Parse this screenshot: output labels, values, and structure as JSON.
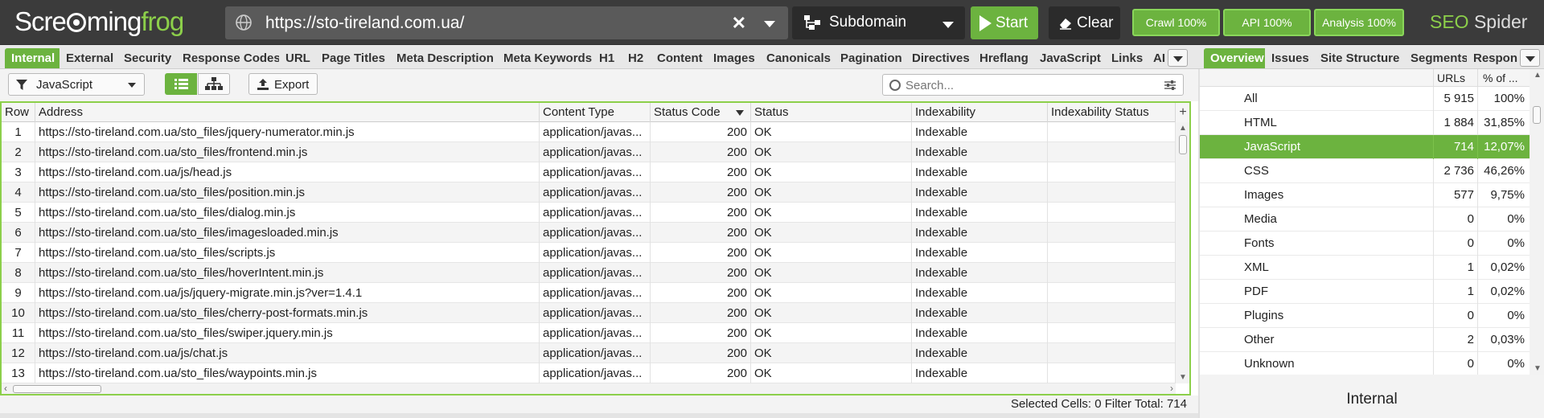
{
  "app": {
    "logo_part1": "Scre",
    "logo_part2": "ming",
    "logo_part3": "frog",
    "brand_seo": "SEO",
    "brand_spider": "Spider",
    "colors": {
      "accent": "#6cb33f",
      "topbar": "#3b3b3b"
    }
  },
  "topbar": {
    "url": "https://sto-tireland.com.ua/",
    "mode": "Subdomain",
    "start_label": "Start",
    "clear_label": "Clear",
    "crawl_label": "Crawl 100%",
    "api_label": "API 100%",
    "analysis_label": "Analysis 100%",
    "icons": [
      "globe-icon",
      "close-icon",
      "chevron-down-icon",
      "sitemap-icon",
      "play-icon",
      "eraser-icon"
    ]
  },
  "tabs": [
    "Internal",
    "External",
    "Security",
    "Response Codes",
    "URL",
    "Page Titles",
    "Meta Description",
    "Meta Keywords",
    "H1",
    "H2",
    "Content",
    "Images",
    "Canonicals",
    "Pagination",
    "Directives",
    "Hreflang",
    "JavaScript",
    "Links",
    "AI"
  ],
  "right_tabs": [
    "Overview",
    "Issues",
    "Site Structure",
    "Segments",
    "Respon"
  ],
  "toolbar": {
    "filter": "JavaScript",
    "export_label": "Export",
    "search_placeholder": "Search..."
  },
  "grid": {
    "columns": [
      "Row",
      "Address",
      "Content Type",
      "Status Code",
      "Status",
      "Indexability",
      "Indexability Status"
    ],
    "rows": [
      [
        "1",
        "https://sto-tireland.com.ua/sto_files/jquery-numerator.min.js",
        "application/javas...",
        "200",
        "OK",
        "Indexable",
        ""
      ],
      [
        "2",
        "https://sto-tireland.com.ua/sto_files/frontend.min.js",
        "application/javas...",
        "200",
        "OK",
        "Indexable",
        ""
      ],
      [
        "3",
        "https://sto-tireland.com.ua/js/head.js",
        "application/javas...",
        "200",
        "OK",
        "Indexable",
        ""
      ],
      [
        "4",
        "https://sto-tireland.com.ua/sto_files/position.min.js",
        "application/javas...",
        "200",
        "OK",
        "Indexable",
        ""
      ],
      [
        "5",
        "https://sto-tireland.com.ua/sto_files/dialog.min.js",
        "application/javas...",
        "200",
        "OK",
        "Indexable",
        ""
      ],
      [
        "6",
        "https://sto-tireland.com.ua/sto_files/imagesloaded.min.js",
        "application/javas...",
        "200",
        "OK",
        "Indexable",
        ""
      ],
      [
        "7",
        "https://sto-tireland.com.ua/sto_files/scripts.js",
        "application/javas...",
        "200",
        "OK",
        "Indexable",
        ""
      ],
      [
        "8",
        "https://sto-tireland.com.ua/sto_files/hoverIntent.min.js",
        "application/javas...",
        "200",
        "OK",
        "Indexable",
        ""
      ],
      [
        "9",
        "https://sto-tireland.com.ua/js/jquery-migrate.min.js?ver=1.4.1",
        "application/javas...",
        "200",
        "OK",
        "Indexable",
        ""
      ],
      [
        "10",
        "https://sto-tireland.com.ua/sto_files/cherry-post-formats.min.js",
        "application/javas...",
        "200",
        "OK",
        "Indexable",
        ""
      ],
      [
        "11",
        "https://sto-tireland.com.ua/sto_files/swiper.jquery.min.js",
        "application/javas...",
        "200",
        "OK",
        "Indexable",
        ""
      ],
      [
        "12",
        "https://sto-tireland.com.ua/js/chat.js",
        "application/javas...",
        "200",
        "OK",
        "Indexable",
        ""
      ],
      [
        "13",
        "https://sto-tireland.com.ua/sto_files/waypoints.min.js",
        "application/javas...",
        "200",
        "OK",
        "Indexable",
        ""
      ]
    ]
  },
  "status": {
    "selected_label": "Selected Cells:",
    "selected_value": "0",
    "filter_label": "Filter Total:",
    "filter_value": "714"
  },
  "overview": {
    "col_urls": "URLs",
    "col_pct": "% of ...",
    "selected": "JavaScript",
    "rows": [
      {
        "label": "All",
        "urls": "5 915",
        "pct": "100%"
      },
      {
        "label": "HTML",
        "urls": "1 884",
        "pct": "31,85%"
      },
      {
        "label": "JavaScript",
        "urls": "714",
        "pct": "12,07%"
      },
      {
        "label": "CSS",
        "urls": "2 736",
        "pct": "46,26%"
      },
      {
        "label": "Images",
        "urls": "577",
        "pct": "9,75%"
      },
      {
        "label": "Media",
        "urls": "0",
        "pct": "0%"
      },
      {
        "label": "Fonts",
        "urls": "0",
        "pct": "0%"
      },
      {
        "label": "XML",
        "urls": "1",
        "pct": "0,02%"
      },
      {
        "label": "PDF",
        "urls": "1",
        "pct": "0,02%"
      },
      {
        "label": "Plugins",
        "urls": "0",
        "pct": "0%"
      },
      {
        "label": "Other",
        "urls": "2",
        "pct": "0,03%"
      },
      {
        "label": "Unknown",
        "urls": "0",
        "pct": "0%"
      }
    ],
    "footer_title": "Internal"
  }
}
